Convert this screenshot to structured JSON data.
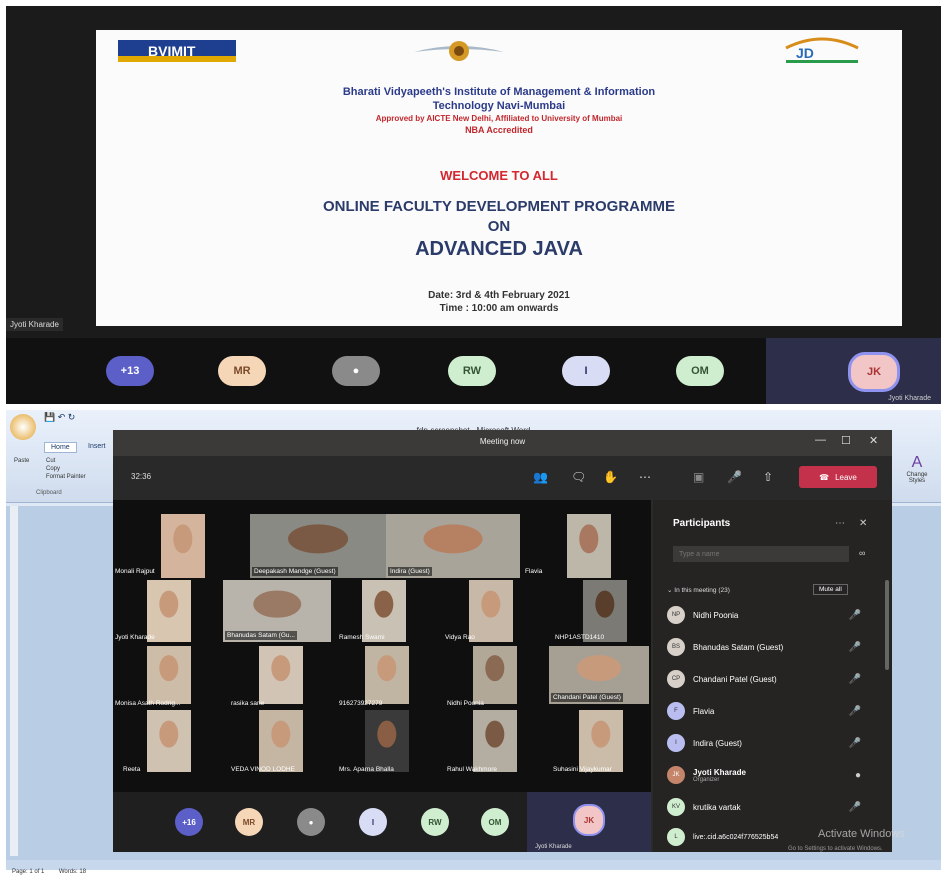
{
  "top": {
    "slide": {
      "logo_left": "BVIMIT",
      "institute": "Bharati Vidyapeeth's Institute of Management & Information",
      "institute2": "Technology Navi-Mumbai",
      "approval": "Approved by AICTE New Delhi, Affiliated to University of Mumbai",
      "nba": "NBA Accredited",
      "welcome": "WELCOME TO ALL",
      "program": "ONLINE FACULTY DEVELOPMENT PROGRAMME",
      "on": "ON",
      "topic": "ADVANCED JAVA",
      "date": "Date: 3rd & 4th February 2021",
      "time": "Time : 10:00 am onwards"
    },
    "presenter": "Jyoti Kharade",
    "avatars": [
      "+13",
      "MR",
      "",
      "RW",
      "I",
      "OM"
    ],
    "jk_initials": "JK",
    "jk_name": "Jyoti Kharade"
  },
  "word": {
    "title": "fdp-screenshot - Microsoft Word",
    "tab_home": "Home",
    "tab_insert": "Insert",
    "cut": "Cut",
    "copy": "Copy",
    "paste": "Paste",
    "format_painter": "Format Painter",
    "clipboard": "Clipboard",
    "change_styles": "Change Styles",
    "status_page": "Page: 1 of 1",
    "status_words": "Words: 18"
  },
  "teams": {
    "title": "Meeting now",
    "timer": "32:36",
    "leave": "Leave",
    "tiles": [
      {
        "label": "Monali Rajput"
      },
      {
        "label": "Deepakash Mandge (Guest)"
      },
      {
        "label": "Indira (Guest)"
      },
      {
        "label": "Flavia"
      },
      {
        "label": "Jyoti Kharade"
      },
      {
        "label": "Bhanudas Satam (Gu..."
      },
      {
        "label": "Ramesh Swami"
      },
      {
        "label": "Vidya Rao"
      },
      {
        "label": "NHP1ASTD1410"
      },
      {
        "label": "Monisa Asath Rodrig..."
      },
      {
        "label": "rasika sane"
      },
      {
        "label": "916273927279"
      },
      {
        "label": "Nidhi Poonia"
      },
      {
        "label": "Chandani Patel (Guest)"
      },
      {
        "label": "Reeta"
      },
      {
        "label": "VEDA VINOD LODHE"
      },
      {
        "label": "Mrs. Aparna Bhalla"
      },
      {
        "label": "Rahul Wakhmore"
      },
      {
        "label": "Suhasini Vijaykumar"
      }
    ],
    "bottom_avatars": [
      "+16",
      "MR",
      "",
      "I",
      "RW",
      "OM"
    ],
    "self_initials": "JK",
    "self_name": "Jyoti Kharade",
    "panel": {
      "title": "Participants",
      "search_placeholder": "Type a name",
      "section": "In this meeting (23)",
      "mute_all": "Mute all",
      "watermark": "Activate Windows",
      "watermark_sub": "Go to Settings to activate Windows.",
      "participants": [
        {
          "initials": "NP",
          "name": "Nidhi Poonia",
          "sub": ""
        },
        {
          "initials": "BS",
          "name": "Bhanudas Satam (Guest)",
          "sub": ""
        },
        {
          "initials": "CP",
          "name": "Chandani Patel (Guest)",
          "sub": ""
        },
        {
          "initials": "F",
          "name": "Flavia",
          "sub": ""
        },
        {
          "initials": "I",
          "name": "Indira (Guest)",
          "sub": ""
        },
        {
          "initials": "JK",
          "name": "Jyoti Kharade",
          "sub": "Organizer"
        },
        {
          "initials": "KV",
          "name": "krutika vartak",
          "sub": ""
        },
        {
          "initials": "L",
          "name": "live:.cid.a6c024f776525b54",
          "sub": ""
        }
      ]
    }
  },
  "colors": {
    "leave": "#c4314b",
    "teams_bg": "#2b2b2b",
    "avatar_purple": "#5b5fc7",
    "avatar_peach": "#f5d7b8",
    "avatar_mint": "#cfeecf",
    "avatar_lilac": "#d8dcf5",
    "avatar_gray": "#8a8a8a"
  }
}
